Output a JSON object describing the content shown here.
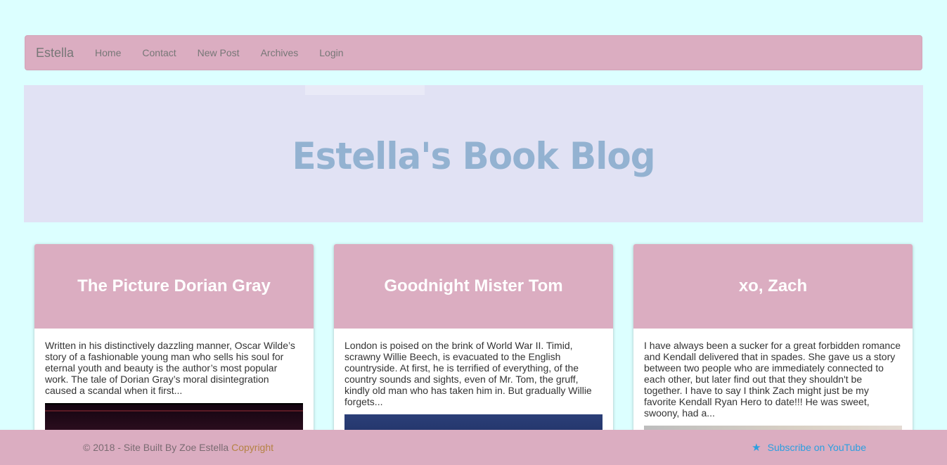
{
  "navbar": {
    "brand": "Estella",
    "links": [
      "Home",
      "Contact",
      "New Post",
      "Archives",
      "Login"
    ]
  },
  "hero": {
    "title": "Estella's Book Blog"
  },
  "cards": [
    {
      "title": "The Picture Dorian Gray",
      "excerpt": "Written in his distinctively dazzling manner, Oscar Wilde’s story of a fashionable young man who sells his soul for eternal youth and beauty is the author’s most popular work. The tale of Dorian Gray’s moral disintegration caused a scandal when it first..."
    },
    {
      "title": "Goodnight Mister Tom",
      "excerpt": "London is poised on the brink of World War II. Timid, scrawny Willie Beech, is evacuated to the English countryside. At first, he is terrified of everything, of the country sounds and sights, even of Mr. Tom, the gruff, kindly old man who has taken him in. But gradually Willie forgets..."
    },
    {
      "title": "xo, Zach",
      "excerpt": "I have always been a sucker for a great forbidden romance and Kendall delivered that in spades. She gave us a story between two people who are immediately connected to each other, but later find out that they shouldn't be together. I have to say I think Zach might just be my favorite Kendall Ryan Hero to date!!! He was sweet, swoony, had a..."
    }
  ],
  "footer": {
    "text": "© 2018 - Site Built By Zoe Estella ",
    "copyright_link": "Copyright",
    "subscribe": "Subscribe on YouTube"
  },
  "colors": {
    "background": "#dcffff",
    "accent_pink": "#dbadc1",
    "hero_bg": "#e1e2f4",
    "hero_title": "#93b2d1",
    "link_blue": "#2b9fe0"
  }
}
